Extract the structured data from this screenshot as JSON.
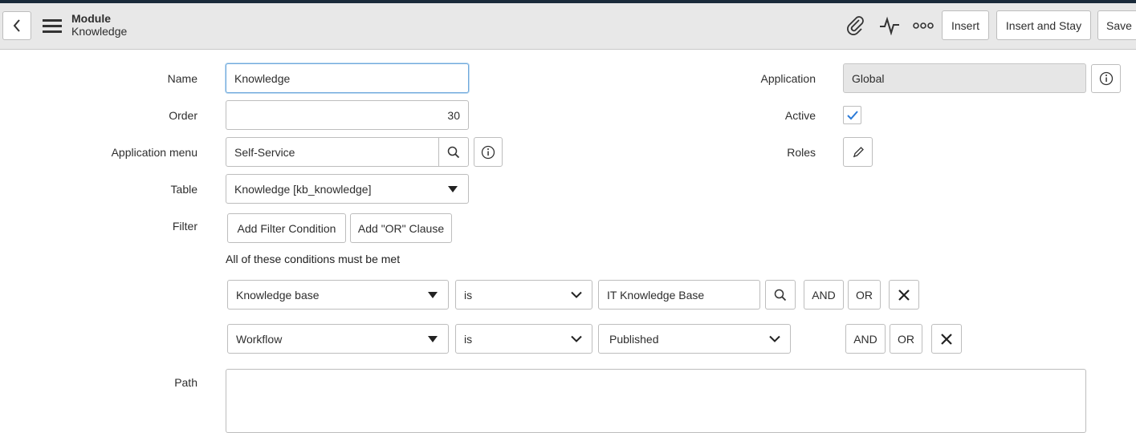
{
  "header": {
    "record_type": "Module",
    "record_name": "Knowledge",
    "buttons": {
      "insert": "Insert",
      "insert_and_stay": "Insert and Stay",
      "save": "Save"
    },
    "icons": [
      "back-icon",
      "hamburger-menu-icon",
      "paperclip-icon",
      "activity-icon",
      "more-options-icon"
    ]
  },
  "form": {
    "name": {
      "label": "Name",
      "value": "Knowledge"
    },
    "order": {
      "label": "Order",
      "value": "30"
    },
    "application_menu": {
      "label": "Application menu",
      "value": "Self-Service"
    },
    "table": {
      "label": "Table",
      "value": "Knowledge [kb_knowledge]"
    },
    "filter": {
      "label": "Filter",
      "add_condition": "Add Filter Condition",
      "add_or": "Add \"OR\" Clause",
      "note": "All of these conditions must be met",
      "conditions": [
        {
          "field": "Knowledge base",
          "operator": "is",
          "value": "IT Knowledge Base",
          "and": "AND",
          "or": "OR"
        },
        {
          "field": "Workflow",
          "operator": "is",
          "value": "Published",
          "and": "AND",
          "or": "OR"
        }
      ]
    },
    "path": {
      "label": "Path",
      "value": ""
    },
    "application": {
      "label": "Application",
      "value": "Global"
    },
    "active": {
      "label": "Active",
      "checked": true
    },
    "roles": {
      "label": "Roles"
    }
  },
  "colors": {
    "focus_border": "#6fa8dc",
    "checkmark": "#2a7ad8",
    "header_bg": "#e8e8e8"
  }
}
